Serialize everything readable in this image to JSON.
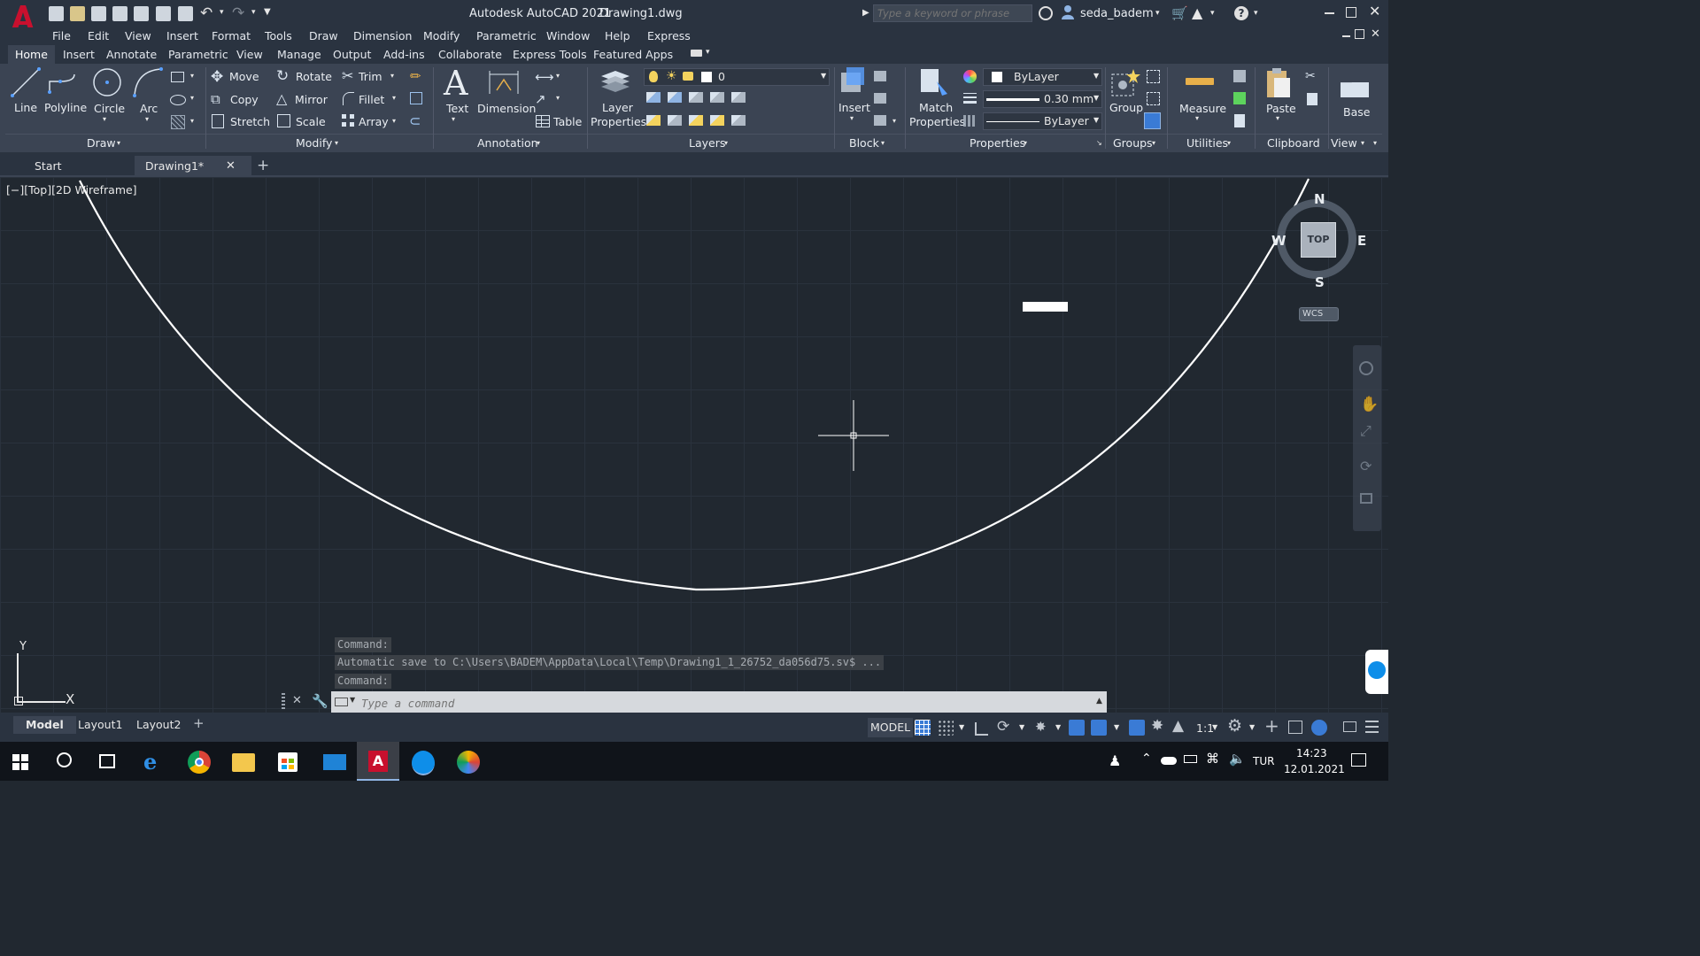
{
  "title_bar": {
    "app_title": "Autodesk AutoCAD 2021",
    "document": "Drawing1.dwg",
    "search_placeholder": "Type a keyword or phrase",
    "user": "seda_badem"
  },
  "menu": [
    "File",
    "Edit",
    "View",
    "Insert",
    "Format",
    "Tools",
    "Draw",
    "Dimension",
    "Modify",
    "Parametric",
    "Window",
    "Help",
    "Express"
  ],
  "ribbon_tabs": [
    "Home",
    "Insert",
    "Annotate",
    "Parametric",
    "View",
    "Manage",
    "Output",
    "Add-ins",
    "Collaborate",
    "Express Tools",
    "Featured Apps"
  ],
  "ribbon": {
    "draw": {
      "title": "Draw",
      "line": "Line",
      "polyline": "Polyline",
      "circle": "Circle",
      "arc": "Arc"
    },
    "modify": {
      "title": "Modify",
      "move": "Move",
      "rotate": "Rotate",
      "trim": "Trim",
      "copy": "Copy",
      "mirror": "Mirror",
      "fillet": "Fillet",
      "stretch": "Stretch",
      "scale": "Scale",
      "array": "Array"
    },
    "annotation": {
      "title": "Annotation",
      "text": "Text",
      "dimension": "Dimension",
      "table": "Table"
    },
    "layers": {
      "title": "Layers",
      "layer_properties_1": "Layer",
      "layer_properties_2": "Properties",
      "current_layer": "0"
    },
    "block": {
      "title": "Block",
      "insert": "Insert"
    },
    "properties": {
      "title": "Properties",
      "match_1": "Match",
      "match_2": "Properties",
      "color": "ByLayer",
      "lineweight": "0.30 mm",
      "linetype": "ByLayer"
    },
    "groups": {
      "title": "Groups",
      "group": "Group"
    },
    "utilities": {
      "title": "Utilities",
      "measure": "Measure"
    },
    "clipboard": {
      "title": "Clipboard",
      "paste": "Paste"
    },
    "view": {
      "title": "View",
      "base": "Base"
    }
  },
  "file_tabs": {
    "start": "Start",
    "drawing": "Drawing1*"
  },
  "viewport_label": "[−][Top][2D Wireframe]",
  "viewcube": {
    "n": "N",
    "s": "S",
    "e": "E",
    "w": "W",
    "top": "TOP",
    "wcs": "WCS"
  },
  "ucs": {
    "x": "X",
    "y": "Y"
  },
  "command_history": [
    "Command:",
    "Automatic save to C:\\Users\\BADEM\\AppData\\Local\\Temp\\Drawing1_1_26752_da056d75.sv$ ...",
    "Command:"
  ],
  "command_placeholder": "Type a command",
  "layout_tabs": [
    "Model",
    "Layout1",
    "Layout2"
  ],
  "status": {
    "model": "MODEL",
    "scale": "1:1"
  },
  "taskbar": {
    "lang": "TUR",
    "time": "14:23",
    "date": "12.01.2021"
  },
  "colors": {
    "accent_red": "#c8102e",
    "highlight_blue": "#3a7bd5"
  }
}
